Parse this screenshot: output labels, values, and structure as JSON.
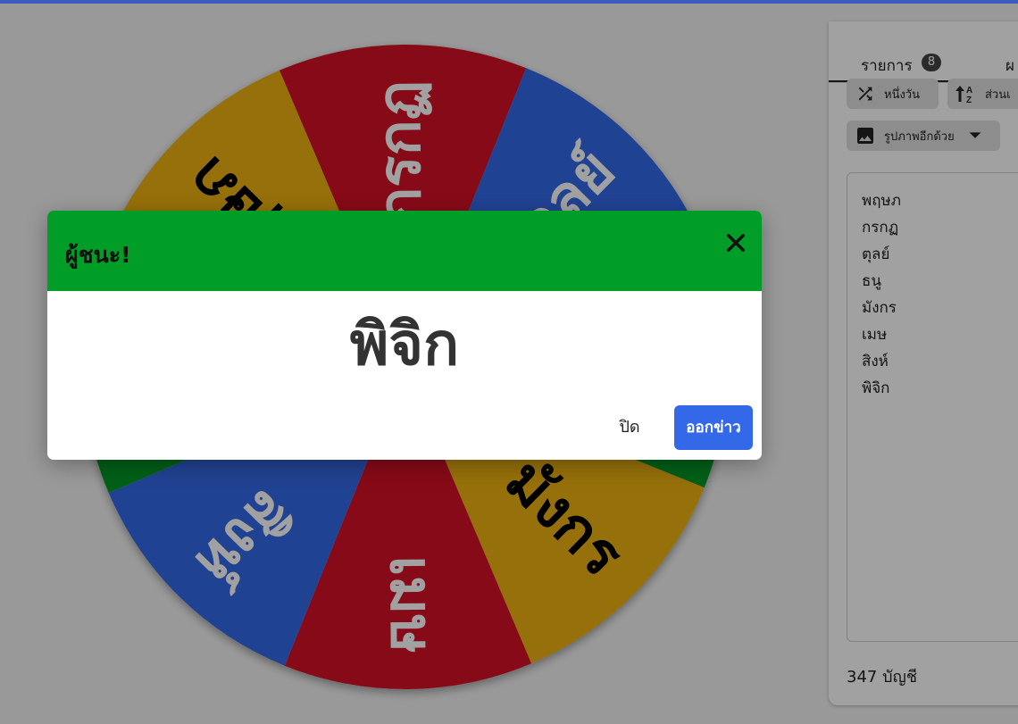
{
  "wheel": {
    "segments": [
      {
        "label": "กรกฏ",
        "color": "#d61126"
      },
      {
        "label": "ตุลย์",
        "color": "#3369e8"
      },
      {
        "label": "ธนู",
        "color": "#009925"
      },
      {
        "label": "มังกร",
        "color": "#eeb211"
      },
      {
        "label": "เมษ",
        "color": "#d61126"
      },
      {
        "label": "สิงห์",
        "color": "#3369e8"
      },
      {
        "label": "พิจิก",
        "color": "#009925"
      },
      {
        "label": "พฤษภ",
        "color": "#eeb211"
      }
    ]
  },
  "panel": {
    "tabs": {
      "entries_label": "รายการ",
      "entries_count": "8",
      "results_label": "ผ"
    },
    "buttons": {
      "shuffle": "หนึ่งวัน",
      "sort": "ส่วนเ",
      "image": "รูปภาพอีกด้วย"
    },
    "entries": [
      "พฤษภ",
      "กรกฏ",
      "ตุลย์",
      "ธนู",
      "มังกร",
      "เมษ",
      "สิงห์",
      "พิจิก"
    ],
    "accounts": "347 บัญชี"
  },
  "modal": {
    "title": "ผู้ชนะ!",
    "winner": "พิจิก",
    "close_label": "ปิด",
    "remove_label": "ออกข่าว"
  },
  "colors": {
    "header_green": "#009e26",
    "primary_blue": "#3369e8"
  },
  "icons": [
    "shuffle-icon",
    "sort-icon",
    "image-icon",
    "chevron-down-icon",
    "close-icon"
  ]
}
